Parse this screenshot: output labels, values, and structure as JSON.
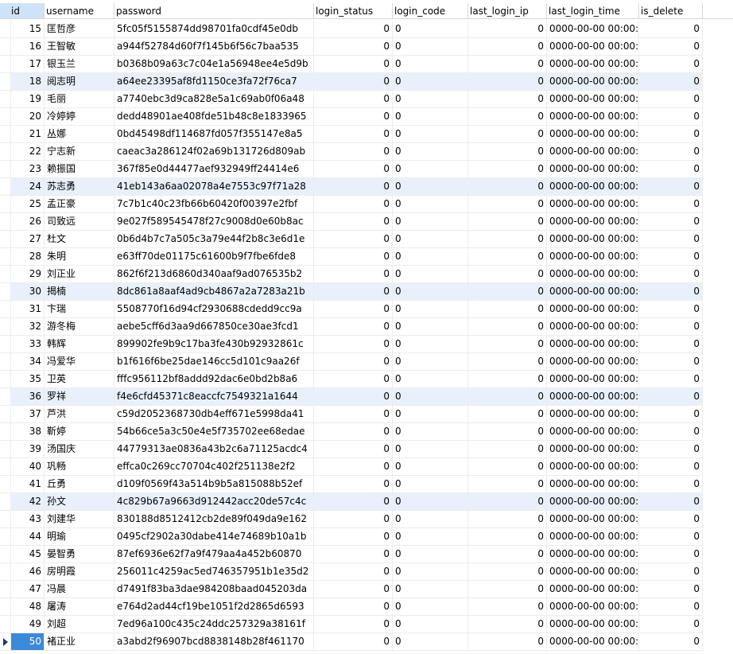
{
  "columns": [
    "id",
    "username",
    "password",
    "login_status",
    "login_code",
    "last_login_ip",
    "last_login_time",
    "is_delete"
  ],
  "active_column": "id",
  "current_row_id": "50",
  "selected_row_ids": [
    "18",
    "24",
    "30",
    "36",
    "42"
  ],
  "rows": [
    {
      "id": "15",
      "username": "匡哲彦",
      "password": "5fc05f5155874dd98701fa0cdf45e0db",
      "login_status": "0",
      "login_code": "0",
      "last_login_ip": "0",
      "last_login_time": "0000-00-00 00:00:0",
      "is_delete": "0"
    },
    {
      "id": "16",
      "username": "王智敏",
      "password": "a944f52784d60f7f145b6f56c7baa535",
      "login_status": "0",
      "login_code": "0",
      "last_login_ip": "0",
      "last_login_time": "0000-00-00 00:00:0",
      "is_delete": "0"
    },
    {
      "id": "17",
      "username": "银玉兰",
      "password": "b0368b09a63c7c04e1a56948ee4e5d9b",
      "login_status": "0",
      "login_code": "0",
      "last_login_ip": "0",
      "last_login_time": "0000-00-00 00:00:0",
      "is_delete": "0"
    },
    {
      "id": "18",
      "username": "阅志明",
      "password": "a64ee23395af8fd1150ce3fa72f76ca7",
      "login_status": "0",
      "login_code": "0",
      "last_login_ip": "0",
      "last_login_time": "0000-00-00 00:00:0",
      "is_delete": "0"
    },
    {
      "id": "19",
      "username": "毛丽",
      "password": "a7740ebc3d9ca828e5a1c69ab0f06a48",
      "login_status": "0",
      "login_code": "0",
      "last_login_ip": "0",
      "last_login_time": "0000-00-00 00:00:0",
      "is_delete": "0"
    },
    {
      "id": "20",
      "username": "冷婷婷",
      "password": "dedd48901ae408fde51b48c8e1833965",
      "login_status": "0",
      "login_code": "0",
      "last_login_ip": "0",
      "last_login_time": "0000-00-00 00:00:0",
      "is_delete": "0"
    },
    {
      "id": "21",
      "username": "丛娜",
      "password": "0bd45498df114687fd057f355147e8a5",
      "login_status": "0",
      "login_code": "0",
      "last_login_ip": "0",
      "last_login_time": "0000-00-00 00:00:0",
      "is_delete": "0"
    },
    {
      "id": "22",
      "username": "宁志新",
      "password": "caeac3a286124f02a69b131726d809ab",
      "login_status": "0",
      "login_code": "0",
      "last_login_ip": "0",
      "last_login_time": "0000-00-00 00:00:0",
      "is_delete": "0"
    },
    {
      "id": "23",
      "username": "赖振国",
      "password": "367f85e0d44477aef932949ff24414e6",
      "login_status": "0",
      "login_code": "0",
      "last_login_ip": "0",
      "last_login_time": "0000-00-00 00:00:0",
      "is_delete": "0"
    },
    {
      "id": "24",
      "username": "苏志勇",
      "password": "41eb143a6aa02078a4e7553c97f71a28",
      "login_status": "0",
      "login_code": "0",
      "last_login_ip": "0",
      "last_login_time": "0000-00-00 00:00:0",
      "is_delete": "0"
    },
    {
      "id": "25",
      "username": "孟正豪",
      "password": "7c7b1c40c23fb66b60420f00397e2fbf",
      "login_status": "0",
      "login_code": "0",
      "last_login_ip": "0",
      "last_login_time": "0000-00-00 00:00:0",
      "is_delete": "0"
    },
    {
      "id": "26",
      "username": "司致远",
      "password": "9e027f589545478f27c9008d0e60b8ac",
      "login_status": "0",
      "login_code": "0",
      "last_login_ip": "0",
      "last_login_time": "0000-00-00 00:00:0",
      "is_delete": "0"
    },
    {
      "id": "27",
      "username": "杜文",
      "password": "0b6d4b7c7a505c3a79e44f2b8c3e6d1e",
      "login_status": "0",
      "login_code": "0",
      "last_login_ip": "0",
      "last_login_time": "0000-00-00 00:00:0",
      "is_delete": "0"
    },
    {
      "id": "28",
      "username": "朱明",
      "password": "e63ff70de01175c61600b9f7fbe6fde8",
      "login_status": "0",
      "login_code": "0",
      "last_login_ip": "0",
      "last_login_time": "0000-00-00 00:00:0",
      "is_delete": "0"
    },
    {
      "id": "29",
      "username": "刘正业",
      "password": "862f6f213d6860d340aaf9ad076535b2",
      "login_status": "0",
      "login_code": "0",
      "last_login_ip": "0",
      "last_login_time": "0000-00-00 00:00:0",
      "is_delete": "0"
    },
    {
      "id": "30",
      "username": "揭楠",
      "password": "8dc861a8aaf4ad9cb4867a2a7283a21b",
      "login_status": "0",
      "login_code": "0",
      "last_login_ip": "0",
      "last_login_time": "0000-00-00 00:00:0",
      "is_delete": "0"
    },
    {
      "id": "31",
      "username": "卞瑞",
      "password": "5508770f16d94cf2930688cdedd9cc9a",
      "login_status": "0",
      "login_code": "0",
      "last_login_ip": "0",
      "last_login_time": "0000-00-00 00:00:0",
      "is_delete": "0"
    },
    {
      "id": "32",
      "username": "游冬梅",
      "password": "aebe5cff6d3aa9d667850ce30ae3fcd1",
      "login_status": "0",
      "login_code": "0",
      "last_login_ip": "0",
      "last_login_time": "0000-00-00 00:00:0",
      "is_delete": "0"
    },
    {
      "id": "33",
      "username": "韩辉",
      "password": "899902fe9b9c17ba3fe430b92932861c",
      "login_status": "0",
      "login_code": "0",
      "last_login_ip": "0",
      "last_login_time": "0000-00-00 00:00:0",
      "is_delete": "0"
    },
    {
      "id": "34",
      "username": "冯爱华",
      "password": "b1f616f6be25dae146cc5d101c9aa26f",
      "login_status": "0",
      "login_code": "0",
      "last_login_ip": "0",
      "last_login_time": "0000-00-00 00:00:0",
      "is_delete": "0"
    },
    {
      "id": "35",
      "username": "卫英",
      "password": "fffc956112bf8addd92dac6e0bd2b8a6",
      "login_status": "0",
      "login_code": "0",
      "last_login_ip": "0",
      "last_login_time": "0000-00-00 00:00:0",
      "is_delete": "0"
    },
    {
      "id": "36",
      "username": "罗祥",
      "password": "f4e6cfd45371c8eaccfc7549321a1644",
      "login_status": "0",
      "login_code": "0",
      "last_login_ip": "0",
      "last_login_time": "0000-00-00 00:00:0",
      "is_delete": "0"
    },
    {
      "id": "37",
      "username": "芦洪",
      "password": "c59d2052368730db4eff671e5998da41",
      "login_status": "0",
      "login_code": "0",
      "last_login_ip": "0",
      "last_login_time": "0000-00-00 00:00:0",
      "is_delete": "0"
    },
    {
      "id": "38",
      "username": "靳婷",
      "password": "54b66ce5a3c50e4e5f735702ee68edae",
      "login_status": "0",
      "login_code": "0",
      "last_login_ip": "0",
      "last_login_time": "0000-00-00 00:00:0",
      "is_delete": "0"
    },
    {
      "id": "39",
      "username": "汤国庆",
      "password": "44779313ae0836a43b2c6a71125acdc4",
      "login_status": "0",
      "login_code": "0",
      "last_login_ip": "0",
      "last_login_time": "0000-00-00 00:00:0",
      "is_delete": "0"
    },
    {
      "id": "40",
      "username": "巩畅",
      "password": "effca0c269cc70704c402f251138e2f2",
      "login_status": "0",
      "login_code": "0",
      "last_login_ip": "0",
      "last_login_time": "0000-00-00 00:00:0",
      "is_delete": "0"
    },
    {
      "id": "41",
      "username": "丘勇",
      "password": "d109f0569f43a514b9b5a815088b52ef",
      "login_status": "0",
      "login_code": "0",
      "last_login_ip": "0",
      "last_login_time": "0000-00-00 00:00:0",
      "is_delete": "0"
    },
    {
      "id": "42",
      "username": "孙文",
      "password": "4c829b67a9663d912442acc20de57c4c",
      "login_status": "0",
      "login_code": "0",
      "last_login_ip": "0",
      "last_login_time": "0000-00-00 00:00:0",
      "is_delete": "0"
    },
    {
      "id": "43",
      "username": "刘建华",
      "password": "830188d8512412cb2de89f049da9e162",
      "login_status": "0",
      "login_code": "0",
      "last_login_ip": "0",
      "last_login_time": "0000-00-00 00:00:0",
      "is_delete": "0"
    },
    {
      "id": "44",
      "username": "明瑜",
      "password": "0495cf2902a30dabe414e74689b10a1b",
      "login_status": "0",
      "login_code": "0",
      "last_login_ip": "0",
      "last_login_time": "0000-00-00 00:00:0",
      "is_delete": "0"
    },
    {
      "id": "45",
      "username": "晏智勇",
      "password": "87ef6936e62f7a9f479aa4a452b60870",
      "login_status": "0",
      "login_code": "0",
      "last_login_ip": "0",
      "last_login_time": "0000-00-00 00:00:0",
      "is_delete": "0"
    },
    {
      "id": "46",
      "username": "房明霞",
      "password": "256011c4259ac5ed746357951b1e35d2",
      "login_status": "0",
      "login_code": "0",
      "last_login_ip": "0",
      "last_login_time": "0000-00-00 00:00:0",
      "is_delete": "0"
    },
    {
      "id": "47",
      "username": "冯晨",
      "password": "d7491f83ba3dae984208baad045203da",
      "login_status": "0",
      "login_code": "0",
      "last_login_ip": "0",
      "last_login_time": "0000-00-00 00:00:0",
      "is_delete": "0"
    },
    {
      "id": "48",
      "username": "屠涛",
      "password": "e764d2ad44cf19be1051f2d2865d6593",
      "login_status": "0",
      "login_code": "0",
      "last_login_ip": "0",
      "last_login_time": "0000-00-00 00:00:0",
      "is_delete": "0"
    },
    {
      "id": "49",
      "username": "刘超",
      "password": "7ed96a100c435c24ddc257329a38161f",
      "login_status": "0",
      "login_code": "0",
      "last_login_ip": "0",
      "last_login_time": "0000-00-00 00:00:0",
      "is_delete": "0"
    },
    {
      "id": "50",
      "username": "褚正业",
      "password": "a3abd2f96907bcd8838148b28f461170",
      "login_status": "0",
      "login_code": "0",
      "last_login_ip": "0",
      "last_login_time": "0000-00-00 00:00:0",
      "is_delete": "0"
    }
  ]
}
